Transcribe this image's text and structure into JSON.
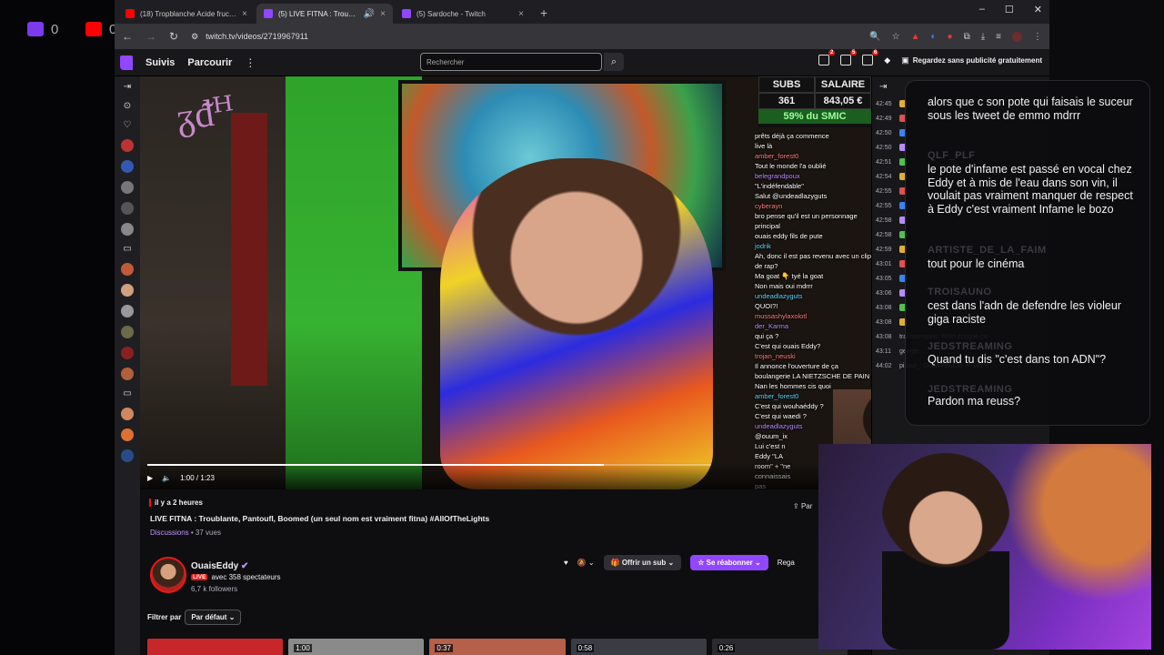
{
  "os": {
    "badges": [
      {
        "count": "0",
        "color": "#7c3aed"
      },
      {
        "count": "0",
        "color": "#ff0000"
      }
    ]
  },
  "tabs": [
    {
      "title": "(18) Tropblanche Acide fructifi...",
      "favicon_color": "#ff0000",
      "active": false
    },
    {
      "title": "(5) LIVE FITNA : Troublante...",
      "favicon_color": "#9147ff",
      "active": true
    },
    {
      "title": "(5) Sardoche - Twitch",
      "favicon_color": "#9147ff",
      "active": false
    }
  ],
  "address_bar": {
    "url": "twitch.tv/videos/2719967911"
  },
  "twitch_nav": {
    "following": "Suivis",
    "browse": "Parcourir",
    "search_placeholder": "Rechercher",
    "notif_counts": [
      "2",
      "5",
      "6"
    ],
    "ad_free": "Regardez sans publicité gratuitement"
  },
  "overlay_stats": {
    "subs_label": "SUBS",
    "salary_label": "SALAIRE",
    "subs_value": "361",
    "salary_value": "843,05 €",
    "smic": "59% du SMIC"
  },
  "overlay_chat": [
    {
      "user": "",
      "msg": "prêts déjà ça commence"
    },
    {
      "user": "",
      "msg": "live là"
    },
    {
      "user": "amber_forest0",
      "msg": "Tout le monde l'a oublié"
    },
    {
      "user": "belegrandpoux",
      "msg": "\"L'indéfendable\""
    },
    {
      "user": "",
      "msg": "Salut @undeadlazyguts"
    },
    {
      "user": "cyberayn",
      "msg": "bro pense qu'il est un personnage principal"
    },
    {
      "user": "",
      "msg": "ouais eddy fils de pute"
    },
    {
      "user": "jodrik",
      "msg": "Ah, donc il est pas revenu avec un clip de rap?"
    },
    {
      "user": "",
      "msg": "Ma goat 👇 tyé la goat"
    },
    {
      "user": "",
      "msg": "Non mais oui mdrrr"
    },
    {
      "user": "undeadlazyguts",
      "msg": "QUOI?!"
    },
    {
      "user": "mussashylaxolotl",
      "msg": ""
    },
    {
      "user": "der_Karma",
      "msg": "qui ça ?"
    },
    {
      "user": "",
      "msg": "C'est qui ouais Eddy?"
    },
    {
      "user": "trojan_neuski",
      "msg": "Il annonce l'ouverture de ça boulangerie LA NIETZSCHE DE PAIN"
    },
    {
      "user": "",
      "msg": "Nan les hommes cis quoi"
    },
    {
      "user": "amber_forest0",
      "msg": "C'est qui wouhaéddy ?"
    },
    {
      "user": "",
      "msg": "C'est qui waedi ?"
    },
    {
      "user": "undeadlazyguts",
      "msg": "@ouum_ix"
    },
    {
      "user": "",
      "msg": "Lui c'est n"
    },
    {
      "user": "",
      "msg": "Eddy \"LA"
    },
    {
      "user": "",
      "msg": "room\" + \"ne"
    },
    {
      "user": "",
      "msg": "connaissais"
    },
    {
      "user": "",
      "msg": "pas"
    }
  ],
  "player": {
    "time": "1:00 / 1:23",
    "progress": 0.81
  },
  "video_info": {
    "ago": "il y a 2 heures",
    "title": "LIVE FITNA : Troublante, Pantoufl, Boomed (un seul nom est vraiment fitna) #AllOfTheLights",
    "category": "Discussions",
    "views": " • 37 vues",
    "share": "Par"
  },
  "channel": {
    "name": "OuaisEddy",
    "verified_icon": "verified-icon",
    "live": "LIVE",
    "viewers": "avec 358 spectateurs",
    "followers": "6,7 k followers",
    "gift_sub": "Offrir un sub",
    "resub": "Se réabonner",
    "watch": "Rega"
  },
  "filter": {
    "label": "Filtrer par",
    "value": "Par défaut"
  },
  "thumbs": [
    {
      "duration": "",
      "color": "#c7262b"
    },
    {
      "duration": "1:00",
      "color": "#8a8a8a"
    },
    {
      "duration": "0:37",
      "color": "#b65f4a"
    },
    {
      "duration": "0:58",
      "color": "#3b3b44"
    },
    {
      "duration": "0:26",
      "color": "#2a2a30"
    }
  ],
  "chat_times": [
    "42:45",
    "42:49",
    "42:50",
    "42:50",
    "42:51",
    "42:54",
    "42:55",
    "42:55",
    "42:58",
    "42:58",
    "42:59",
    "43:01",
    "43:05",
    "43:06",
    "43:08",
    "43:08"
  ],
  "chat_tail": [
    {
      "time": "43:08",
      "text": "transtemguns: Belle époque ça"
    },
    {
      "time": "43:11",
      "text": "george..."
    },
    {
      "time": "44:02",
      "text": "pipaul_: OuaisPeluche en place"
    }
  ],
  "floating_chat": [
    {
      "user": "",
      "msg": "alors que c son pote qui faisais le suceur sous les tweet de emmo mdrrr"
    },
    {
      "user": "QLF_PLF",
      "msg": "le pote d'infame est passé en vocal chez Eddy et à mis de l'eau dans son vin, il voulait pas vraiment manquer de respect à Eddy c'est vraiment Infame le bozo"
    },
    {
      "user": "ARTISTE_DE_LA_FAIM",
      "msg": "tout pour le cinéma"
    },
    {
      "user": "TROISAUNO",
      "msg": "cest dans l'adn de defendre les violeur giga raciste"
    },
    {
      "user": "JEDSTREAMING",
      "msg": "Quand tu dis \"c'est dans ton ADN\"?"
    },
    {
      "user": "JEDSTREAMING",
      "msg": "Pardon ma reuss?"
    }
  ]
}
